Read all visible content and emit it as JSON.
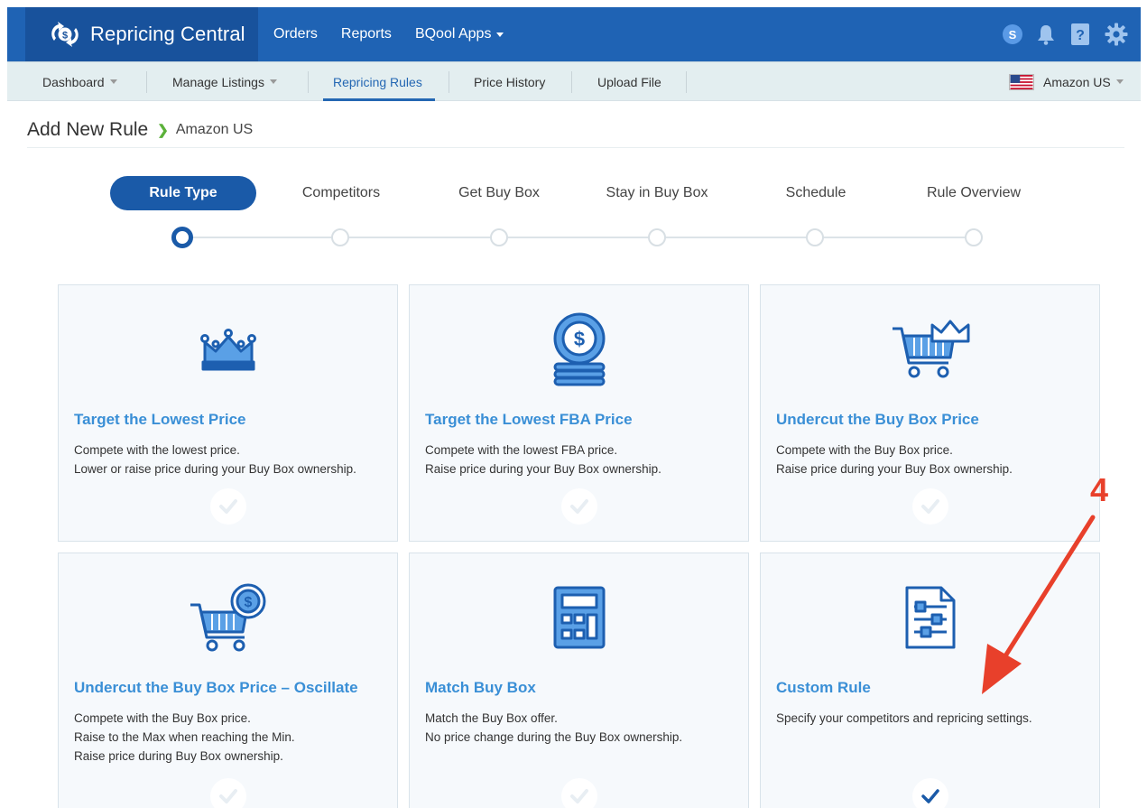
{
  "app": {
    "name": "Repricing Central",
    "top_nav": [
      "Orders",
      "Reports",
      "BQool Apps"
    ],
    "user_initial": "S"
  },
  "subnav": {
    "items": [
      "Dashboard",
      "Manage Listings",
      "Repricing Rules",
      "Price History",
      "Upload File"
    ],
    "active": "Repricing Rules",
    "marketplace": "Amazon US"
  },
  "page": {
    "title": "Add New Rule",
    "crumb": "Amazon US"
  },
  "steps": {
    "labels": [
      "Rule Type",
      "Competitors",
      "Get Buy Box",
      "Stay in Buy Box",
      "Schedule",
      "Rule Overview"
    ],
    "current": "Rule Type"
  },
  "cards": [
    {
      "title": "Target the Lowest Price",
      "desc": [
        "Compete with the lowest price.",
        "Lower or raise price during your Buy Box ownership."
      ],
      "icon": "crown-icon",
      "selected": false
    },
    {
      "title": "Target the Lowest FBA Price",
      "desc": [
        "Compete with the lowest FBA price.",
        "Raise price during your Buy Box ownership."
      ],
      "icon": "coin-stack-icon",
      "selected": false
    },
    {
      "title": "Undercut the Buy Box Price",
      "desc": [
        "Compete with the Buy Box price.",
        "Raise price during your Buy Box ownership."
      ],
      "icon": "cart-crown-icon",
      "selected": false
    },
    {
      "title": "Undercut the Buy Box Price – Oscillate",
      "desc": [
        "Compete with the Buy Box price.",
        "Raise to the Max when reaching the Min.",
        "Raise price during Buy Box ownership."
      ],
      "icon": "cart-coin-icon",
      "selected": false
    },
    {
      "title": "Match Buy Box",
      "desc": [
        "Match the Buy Box offer.",
        "No price change during the Buy Box ownership."
      ],
      "icon": "calculator-icon",
      "selected": false
    },
    {
      "title": "Custom Rule",
      "desc": [
        "Specify your competitors and repricing settings."
      ],
      "icon": "settings-document-icon",
      "selected": true
    }
  ],
  "annotation": {
    "label": "4"
  },
  "colors": {
    "primary": "#1f63b4",
    "brand_dark": "#18529c",
    "accent_link": "#3a8fd6",
    "annotation": "#e8402b",
    "check": "#1a5aa8"
  }
}
